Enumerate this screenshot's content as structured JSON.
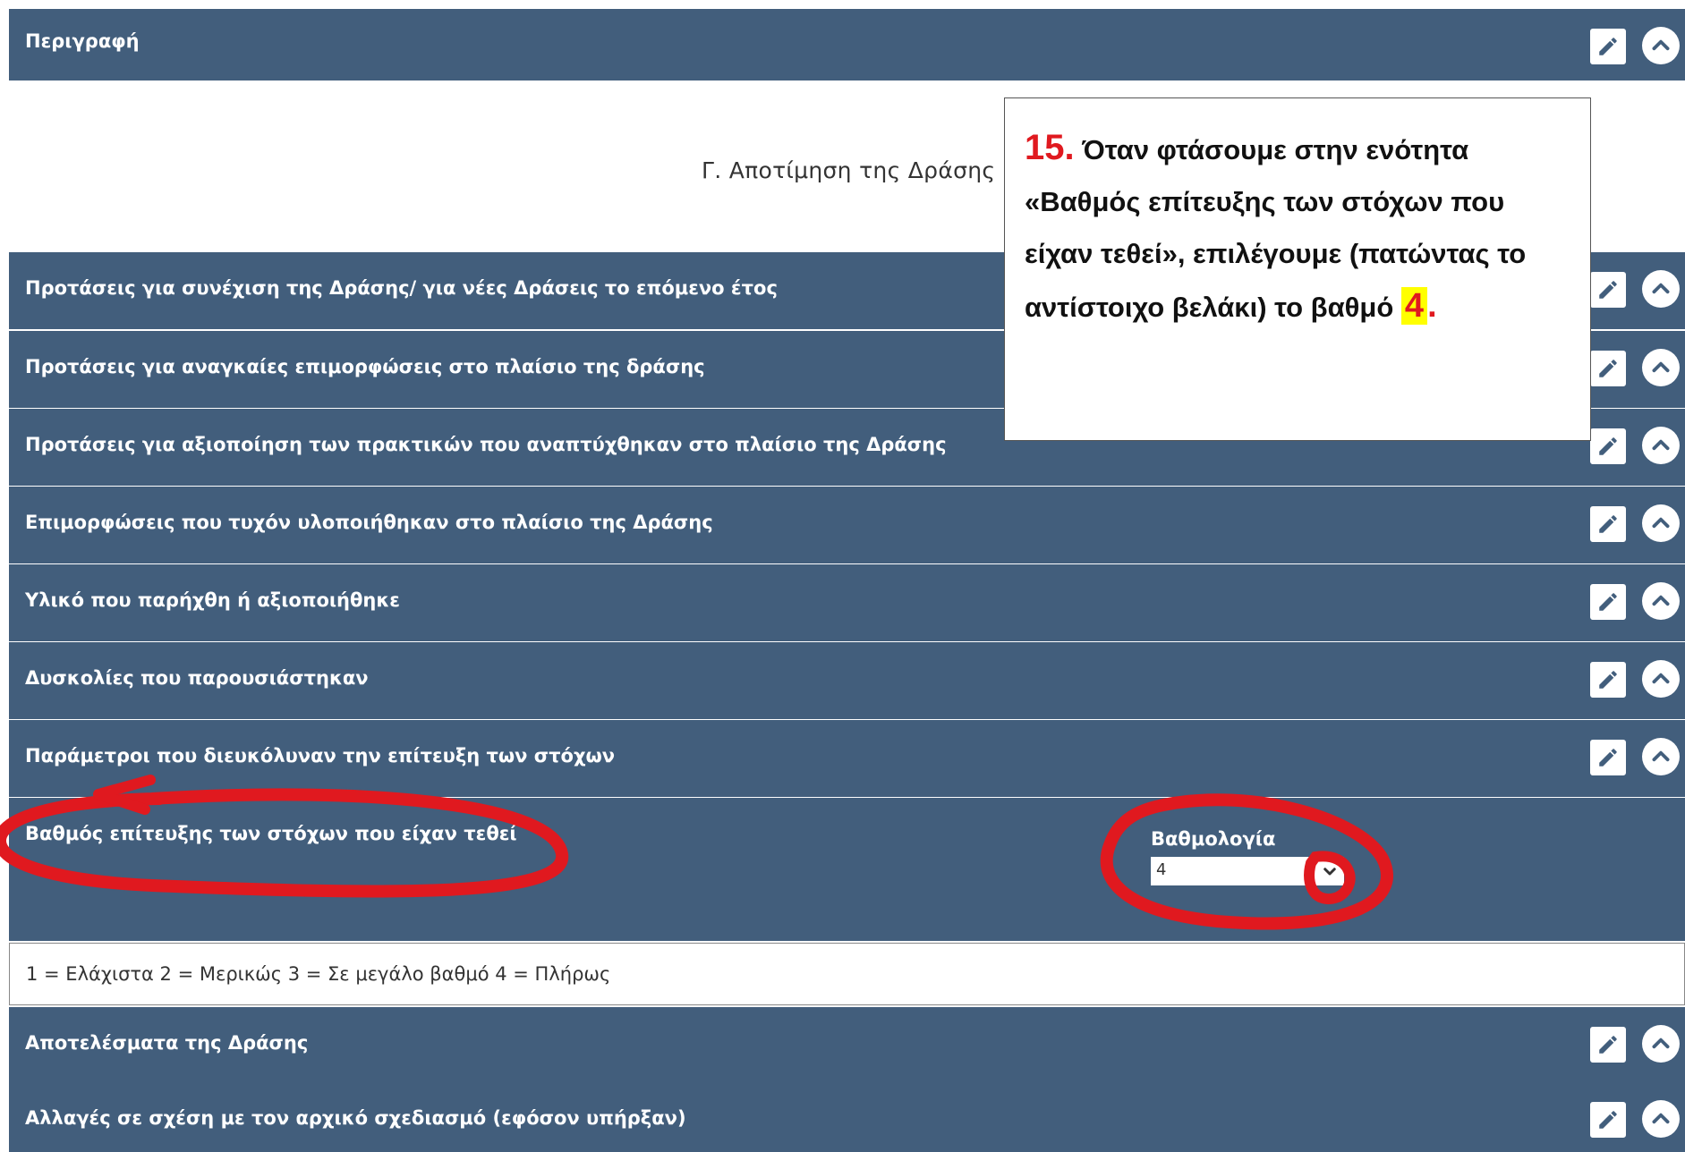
{
  "top_panel": {
    "title": "Περιγραφή"
  },
  "section": {
    "title": "Γ. Αποτίμηση της Δράσης"
  },
  "panels": [
    {
      "label": "Προτάσεις για συνέχιση της Δράσης/ για νέες Δράσεις το επόμενο έτος"
    },
    {
      "label": "Προτάσεις για αναγκαίες επιμορφώσεις στο πλαίσιο της δράσης"
    },
    {
      "label": "Προτάσεις για αξιοποίηση των πρακτικών που αναπτύχθηκαν στο πλαίσιο της Δράσης"
    },
    {
      "label": "Επιμορφώσεις που τυχόν υλοποιήθηκαν στο πλαίσιο της Δράσης"
    },
    {
      "label": "Υλικό που παρήχθη ή αξιοποιήθηκε"
    },
    {
      "label": "Δυσκολίες που παρουσιάστηκαν"
    },
    {
      "label": "Παράμετροι που διευκόλυναν την επίτευξη των στόχων"
    }
  ],
  "rating_panel": {
    "label": "Βαθμός επίτευξης των στόχων που είχαν τεθεί",
    "field_label": "Βαθμολογία",
    "selected": "4"
  },
  "scale_note": "1 = Ελάχιστα 2 = Μερικώς 3 = Σε μεγάλο βαθμό 4 = Πλήρως",
  "bottom_panels": [
    {
      "label": "Αποτελέσματα της Δράσης"
    },
    {
      "label": "Αλλαγές σε σχέση με τον αρχικό σχεδιασμό (εφόσον υπήρξαν)"
    }
  ],
  "callout": {
    "number": "15.",
    "text_main": "Όταν  φτάσουμε στην ενότητα «Βαθμός επίτευξης των στόχων που είχαν τεθεί», επιλέγουμε (πατώντας το αντίστοιχο βελάκι) το βαθμό",
    "grade": "4",
    "end": "."
  },
  "icons": {
    "edit": "pencil-icon",
    "toggle": "chevron-up-icon",
    "dropdown": "chevron-down-icon"
  },
  "colors": {
    "panel_bg": "#425e7c",
    "highlight_red": "#e0191f",
    "highlight_yellow": "#ffff00"
  }
}
